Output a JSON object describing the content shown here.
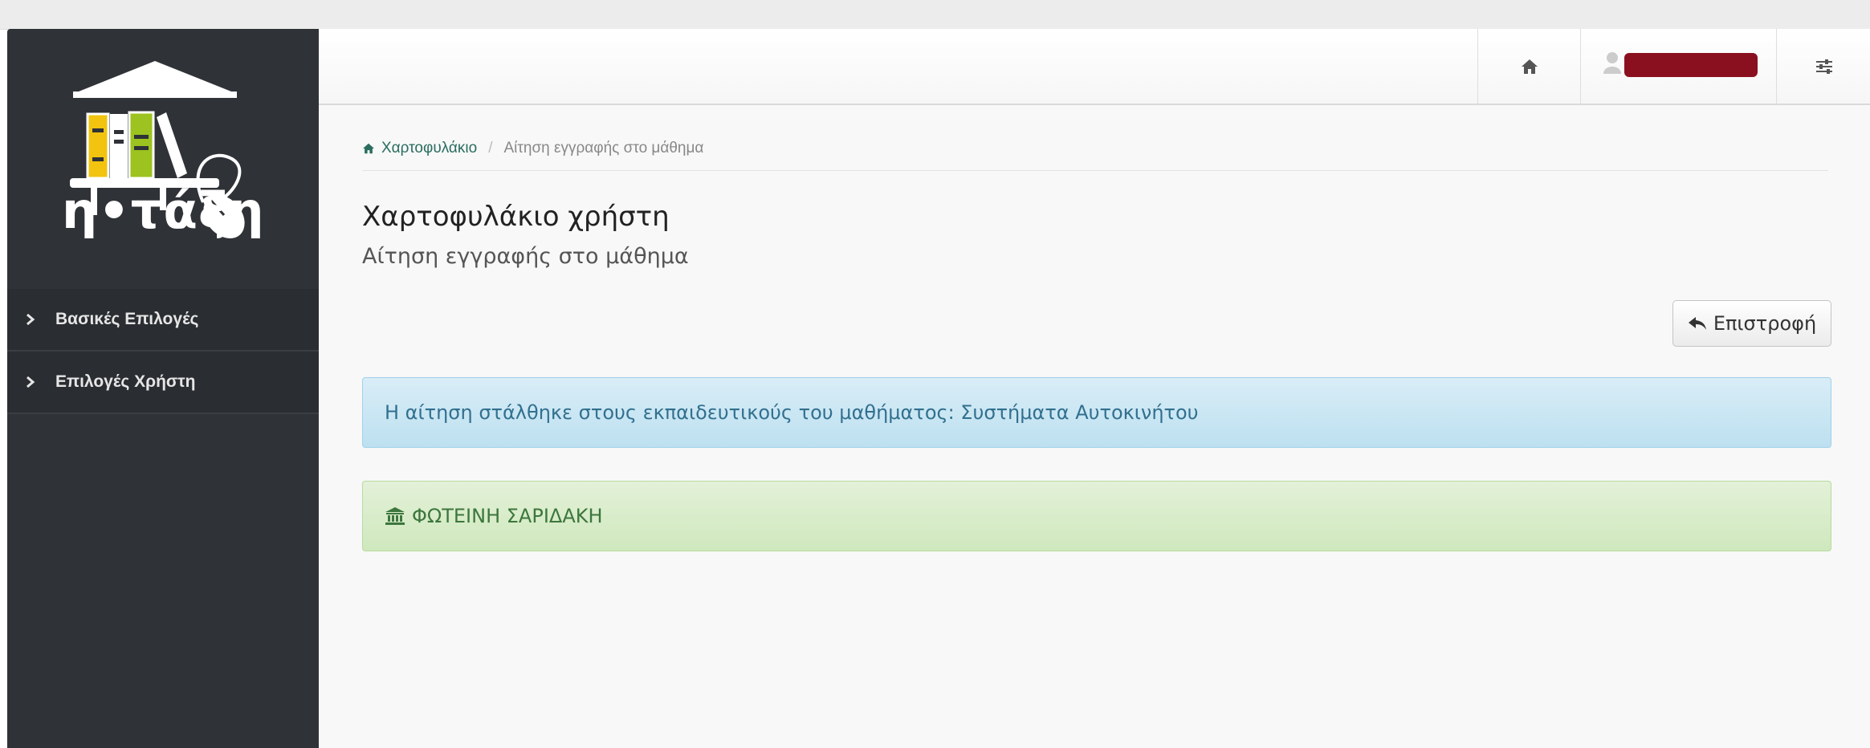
{
  "app": {
    "logo_text": "η•τάξη"
  },
  "sidebar": {
    "items": [
      {
        "label": "Βασικές Επιλογές",
        "icon": "chevron-right-icon"
      },
      {
        "label": "Επιλογές Χρήστη",
        "icon": "chevron-right-icon"
      }
    ]
  },
  "navbar": {
    "home_icon": "home-icon",
    "user_icon": "user-icon",
    "user_name": "",
    "settings_icon": "sliders-icon",
    "user_name_redaction_color": "#8a1020"
  },
  "breadcrumb": {
    "home_label": "Χαρτοφυλάκιο",
    "separator": "/",
    "current_label": "Αίτηση εγγραφής στο μάθημα"
  },
  "page": {
    "title": "Χαρτοφυλάκιο χρήστη",
    "subtitle": "Αίτηση εγγραφής στο μάθημα"
  },
  "actions": {
    "back_label": "Επιστροφή",
    "back_icon": "reply-icon"
  },
  "alerts": {
    "info_text": "Η αίτηση στάλθηκε στους εκπαιδευτικούς του μαθήματος: Συστήματα Αυτοκινήτου",
    "success_icon": "institution-icon",
    "success_text": "ΦΩΤΕΙΝΗ ΣΑΡΙΔΑΚΗ"
  },
  "colors": {
    "sidebar_bg": "#2f3237",
    "info_bg": "#d9edf7",
    "info_text": "#31708f",
    "success_bg": "#dff0d8",
    "success_text": "#3c763d",
    "link": "#2a6d5e"
  }
}
